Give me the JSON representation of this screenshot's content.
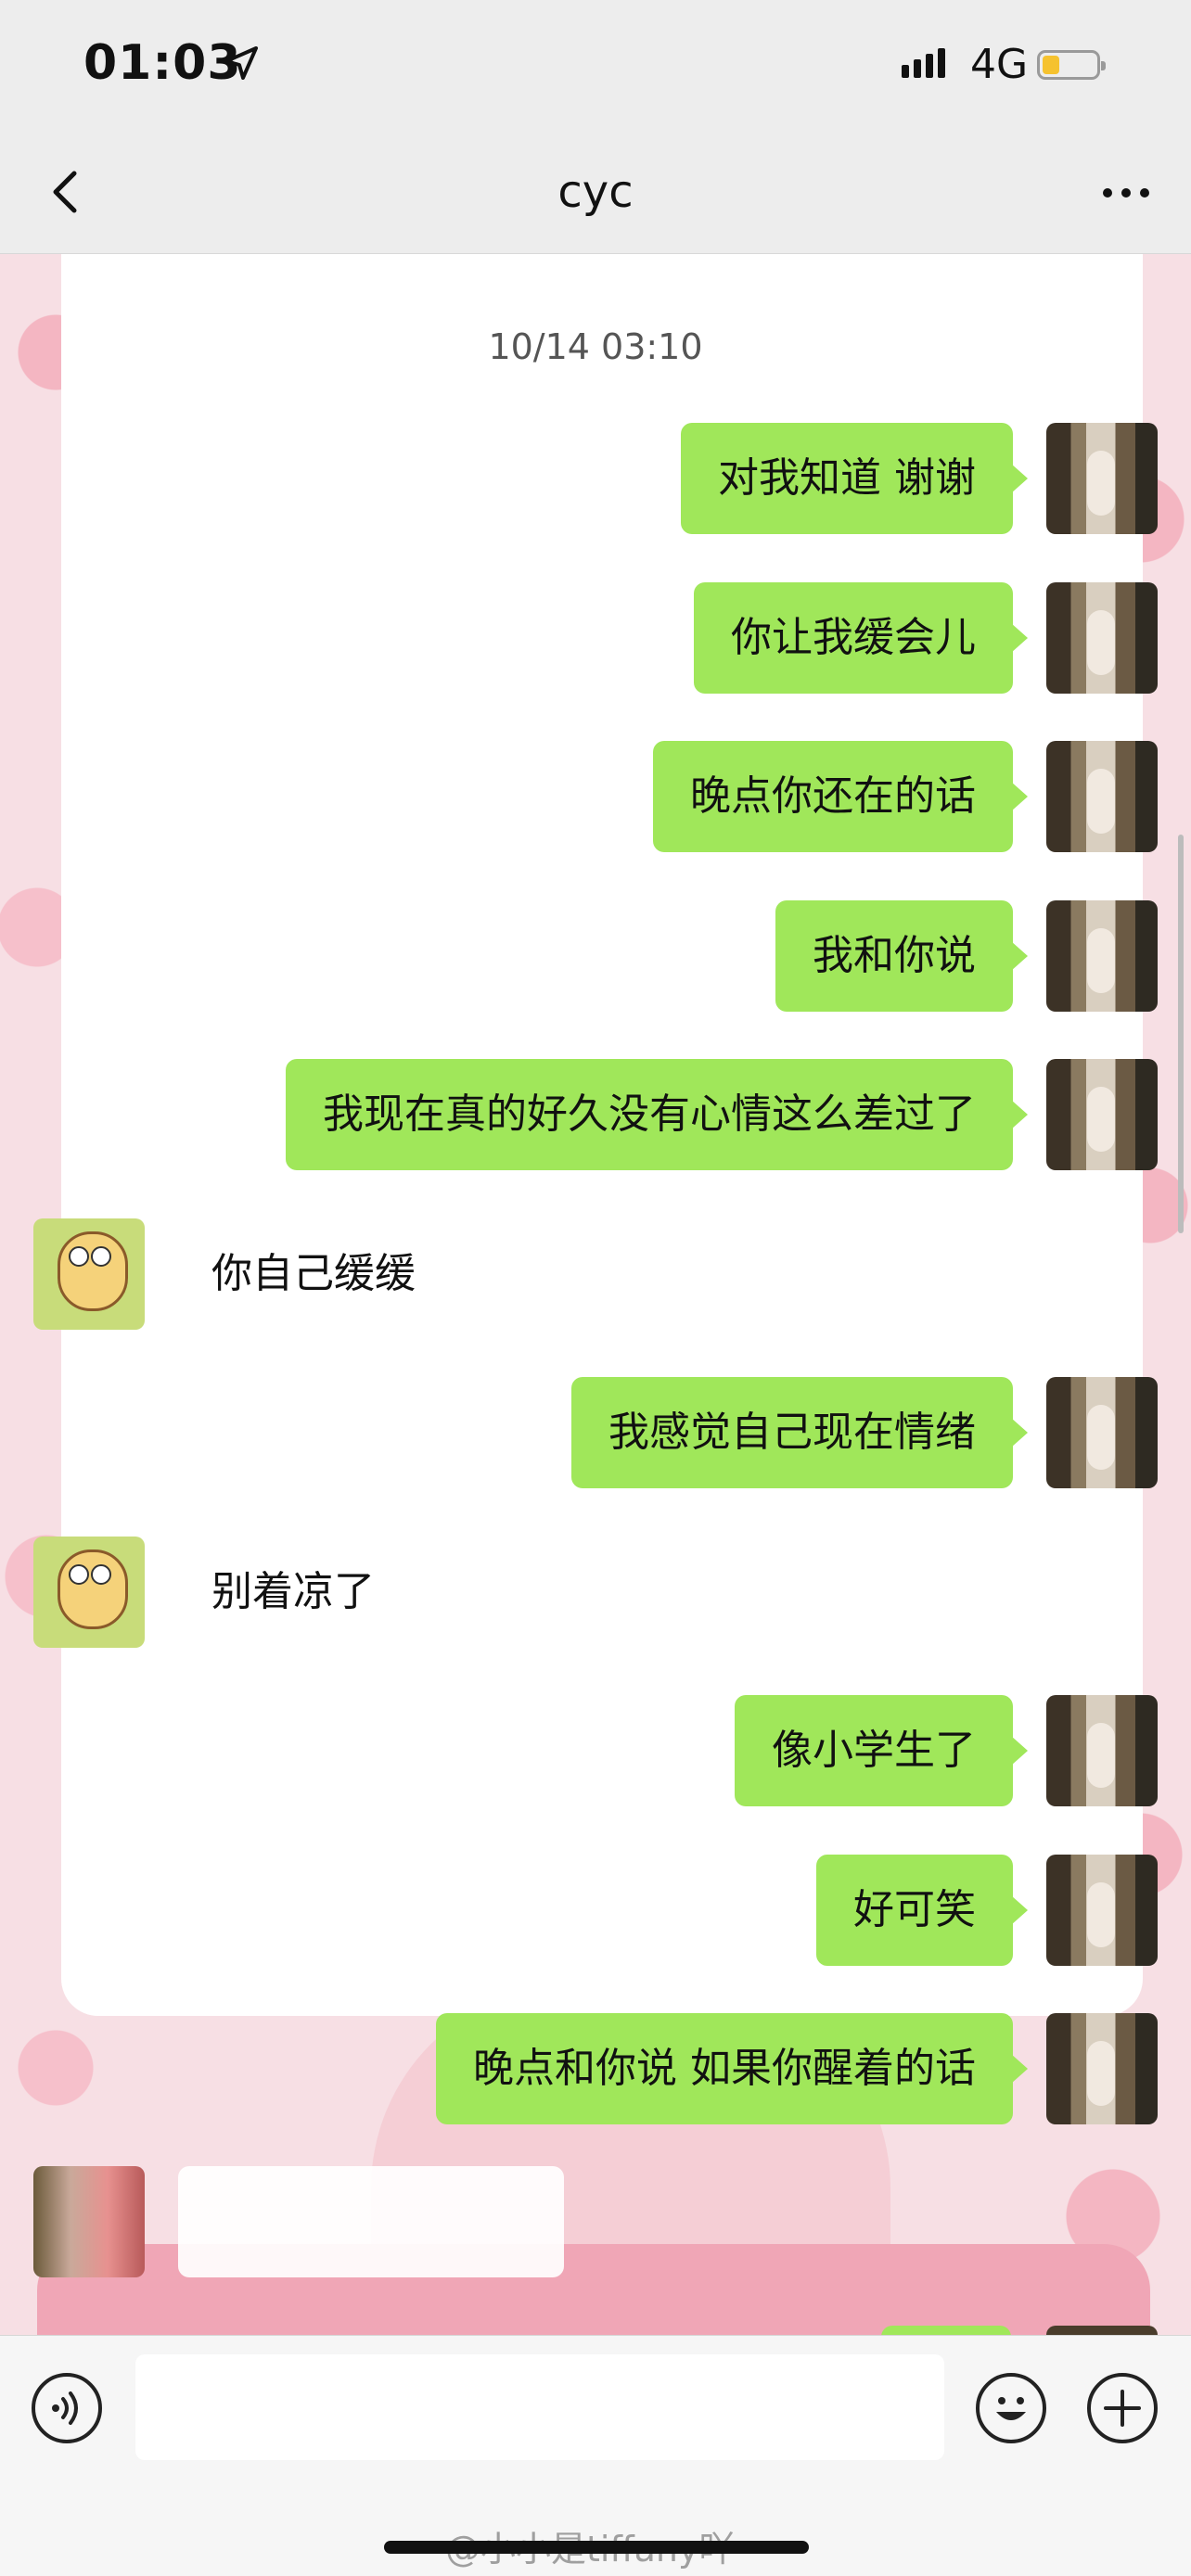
{
  "status_bar": {
    "time": "01:03",
    "network": "4G",
    "battery_level": 0.3
  },
  "nav": {
    "title": "cyc"
  },
  "chat": {
    "timestamp": "10/14 03:10",
    "messages": [
      {
        "sender": "me",
        "text": "对我知道 谢谢"
      },
      {
        "sender": "me",
        "text": "你让我缓会儿"
      },
      {
        "sender": "me",
        "text": "晚点你还在的话"
      },
      {
        "sender": "me",
        "text": "我和你说"
      },
      {
        "sender": "me",
        "text": "我现在真的好久没有心情这么差过了"
      },
      {
        "sender": "other",
        "text": "你自己缓缓"
      },
      {
        "sender": "me",
        "text": "我感觉自己现在情绪"
      },
      {
        "sender": "other",
        "text": "别着凉了"
      },
      {
        "sender": "me",
        "text": "像小学生了"
      },
      {
        "sender": "me",
        "text": "好可笑"
      },
      {
        "sender": "me",
        "text": "晚点和你说 如果你醒着的话"
      }
    ]
  },
  "input": {
    "value": "",
    "placeholder": ""
  },
  "watermark": "@小小是tiffany吖",
  "colors": {
    "my_bubble": "#a0e75a",
    "their_bubble": "#ffffff",
    "bars": "#ededed"
  }
}
